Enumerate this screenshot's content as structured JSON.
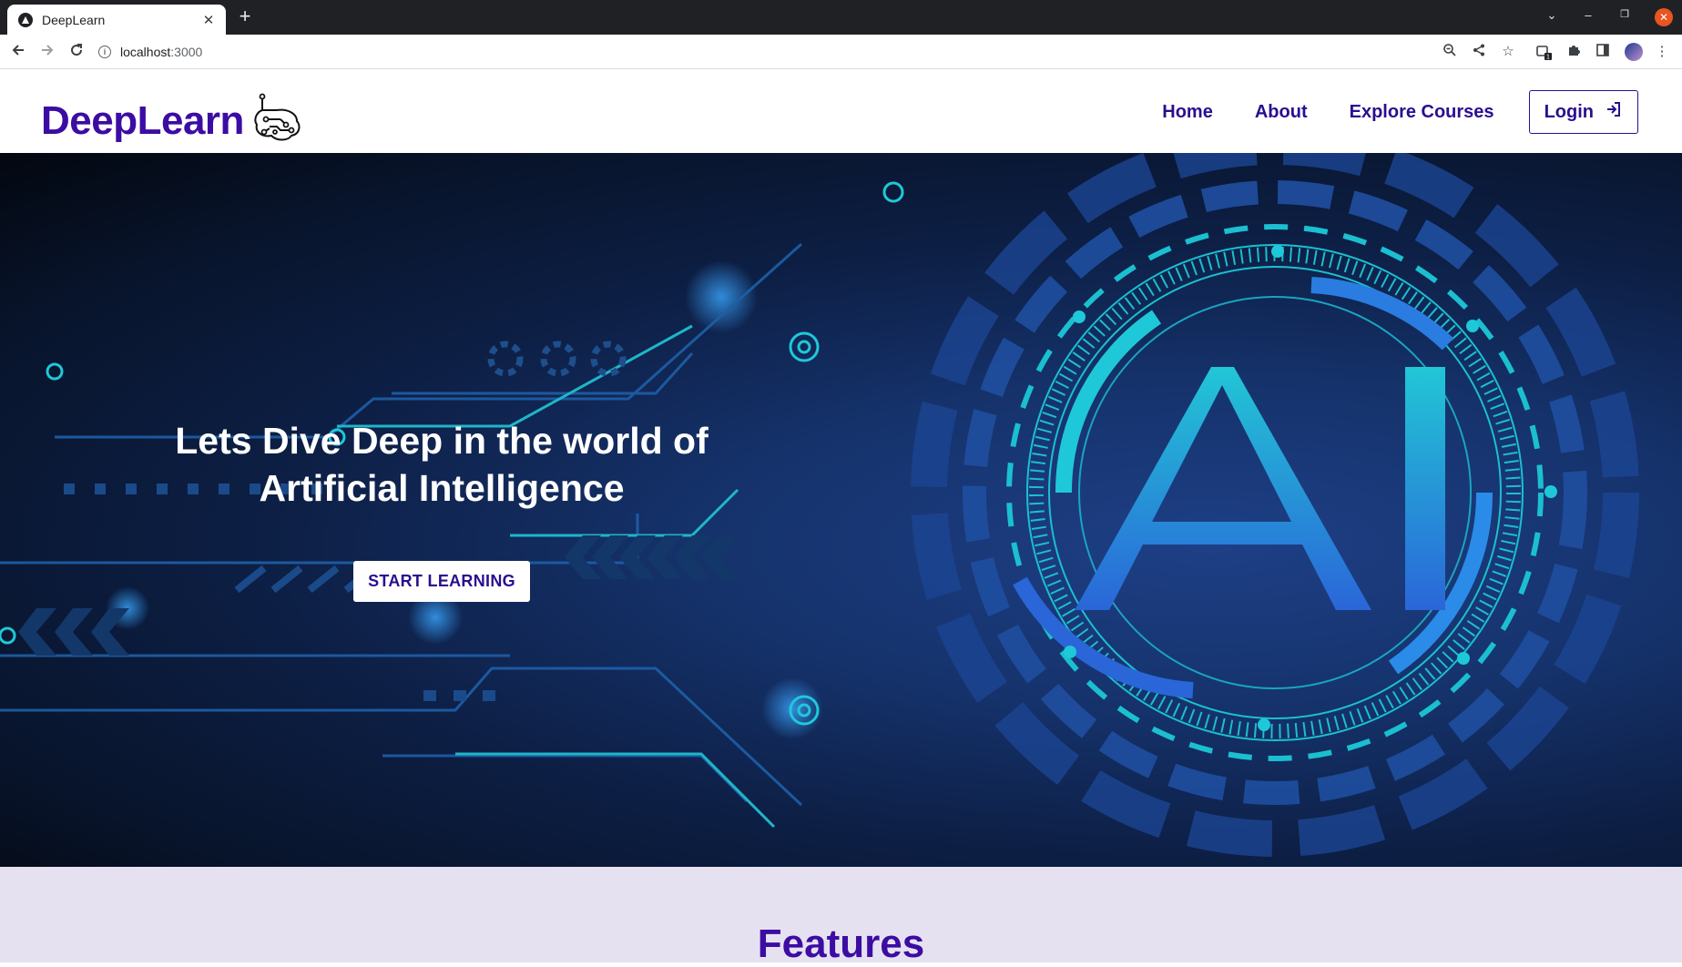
{
  "browser": {
    "tab_title": "DeepLearn",
    "tab_close": "✕",
    "new_tab": "+",
    "url_host": "localhost",
    "url_port": ":3000",
    "extension_badge": "1"
  },
  "site": {
    "logo_text": "DeepLearn",
    "nav": {
      "home": "Home",
      "about": "About",
      "explore": "Explore Courses",
      "login": "Login"
    }
  },
  "hero": {
    "title_line1": "Lets Dive Deep in the world of",
    "title_line2": "Artificial Intelligence",
    "cta": "START LEARNING",
    "art_label": "AI"
  },
  "features": {
    "title": "Features"
  },
  "colors": {
    "brand": "#3c0ca3",
    "nav": "#2a0e8f",
    "features_bg": "#e6e1f1",
    "hero_cyan": "#1fc8d8",
    "hero_blue": "#2b6fe0"
  },
  "icons": [
    "back-arrow-icon",
    "forward-arrow-icon",
    "reload-icon",
    "info-icon",
    "zoom-icon",
    "share-icon",
    "star-icon",
    "extension-icon",
    "puzzle-icon",
    "sidepanel-icon",
    "menu-icon",
    "circuit-brain-icon",
    "login-enter-icon"
  ]
}
